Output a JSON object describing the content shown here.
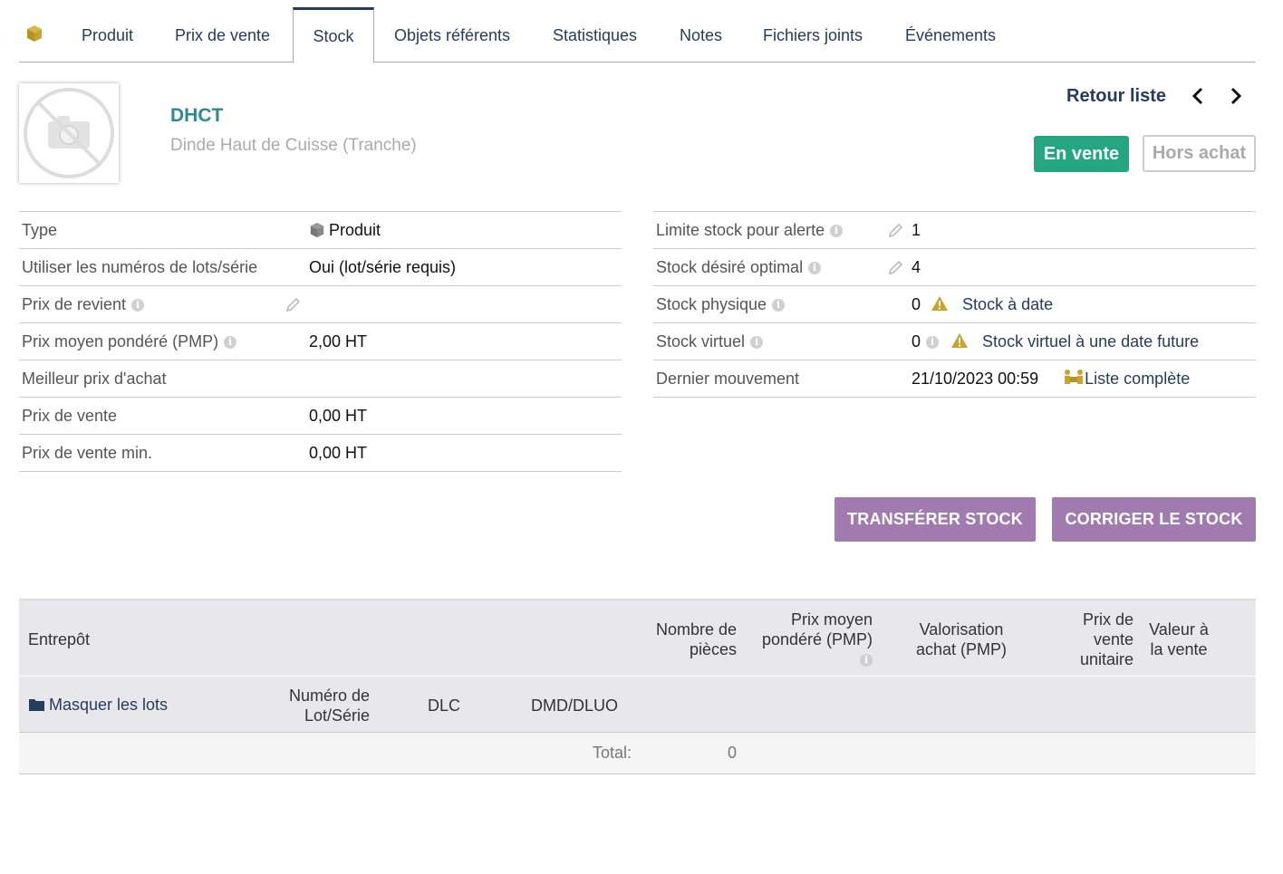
{
  "tabs": [
    {
      "label": "Produit"
    },
    {
      "label": "Prix de vente"
    },
    {
      "label": "Stock"
    },
    {
      "label": "Objets référents"
    },
    {
      "label": "Statistiques"
    },
    {
      "label": "Notes"
    },
    {
      "label": "Fichiers joints"
    },
    {
      "label": "Événements"
    }
  ],
  "active_tab": "Stock",
  "product": {
    "ref": "DHCT",
    "label": "Dinde Haut de Cuisse (Tranche)"
  },
  "nav": {
    "back_list": "Retour liste"
  },
  "status": {
    "sell": "En vente",
    "buy": "Hors achat"
  },
  "left_fields": [
    {
      "key": "Type",
      "value": "Produit"
    },
    {
      "key": "Utiliser les numéros de lots/série",
      "value": "Oui (lot/série requis)"
    },
    {
      "key": "Prix de revient",
      "value": ""
    },
    {
      "key": "Prix moyen pondéré (PMP)",
      "value": "2,00 HT"
    },
    {
      "key": "Meilleur prix d'achat",
      "value": ""
    },
    {
      "key": "Prix de vente",
      "value": "0,00 HT"
    },
    {
      "key": "Prix de vente min.",
      "value": "0,00 HT"
    }
  ],
  "right_fields": [
    {
      "key": "Limite stock pour alerte",
      "value": "1"
    },
    {
      "key": "Stock désiré optimal",
      "value": "4"
    },
    {
      "key": "Stock physique",
      "value": "0",
      "link": "Stock à date"
    },
    {
      "key": "Stock virtuel",
      "value": "0",
      "link": "Stock virtuel à une date future"
    },
    {
      "key": "Dernier mouvement",
      "value": "21/10/2023 00:59",
      "link": "Liste complète"
    }
  ],
  "buttons": {
    "transfer": "TRANSFÉRER STOCK",
    "correct": "CORRIGER LE STOCK"
  },
  "warehouse_table": {
    "headers": {
      "warehouse": "Entrepôt",
      "pieces": [
        "Nombre de",
        "pièces"
      ],
      "pmp": [
        "Prix moyen",
        "pondéré (PMP)"
      ],
      "valuation": [
        "Valorisation",
        "achat (PMP)"
      ],
      "unit_price": [
        "Prix de",
        "vente",
        "unitaire"
      ],
      "sale_value": [
        "Valeur à",
        "la vente"
      ]
    },
    "lots_row": {
      "hide_lots": "Masquer les lots",
      "lot_number": [
        "Numéro de",
        "Lot/Série"
      ],
      "dlc": "DLC",
      "dmd": "DMD/DLUO"
    },
    "total": {
      "label": "Total:",
      "pieces": "0"
    }
  },
  "colors": {
    "primary": "#263c5c",
    "accent_teal": "#2c8a8f",
    "sell_green": "#25a580",
    "button_purple": "#a17bb0",
    "warning": "#c9a32c"
  }
}
